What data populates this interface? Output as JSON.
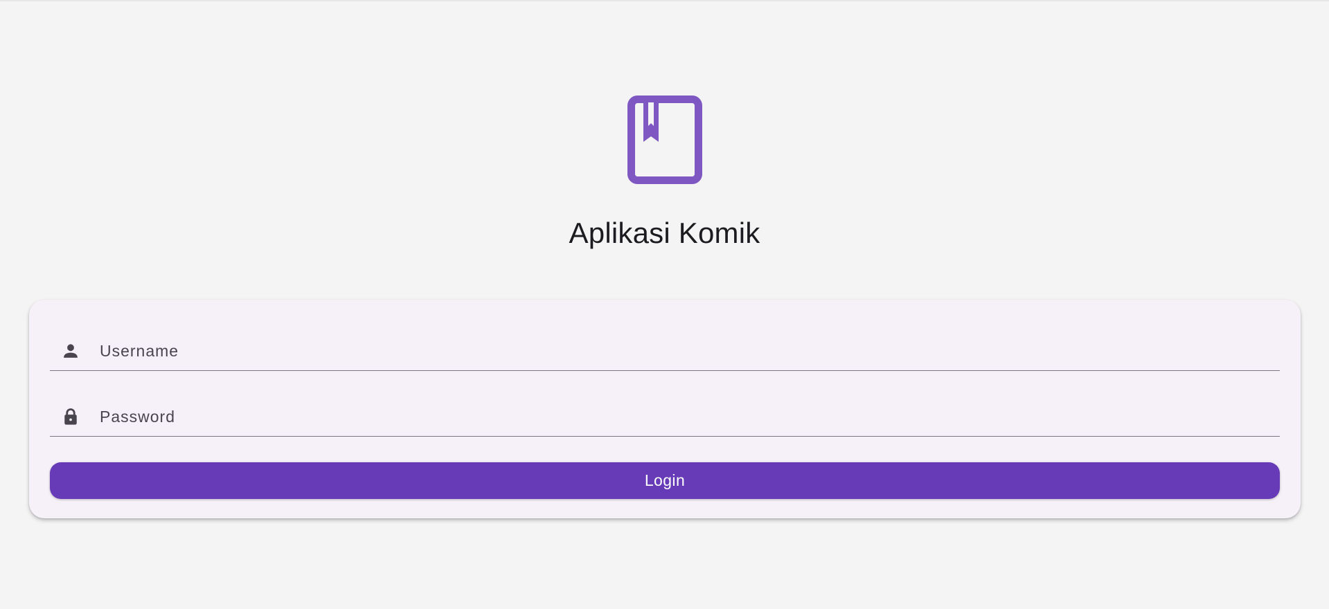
{
  "app": {
    "title": "Aplikasi Komik",
    "logo_icon": "book-bookmark-icon",
    "brand_color": "#7e57c2"
  },
  "login_form": {
    "username": {
      "placeholder": "Username",
      "value": "",
      "icon": "person-icon"
    },
    "password": {
      "placeholder": "Password",
      "value": "",
      "icon": "lock-icon"
    },
    "submit_label": "Login",
    "submit_color": "#673ab7"
  }
}
